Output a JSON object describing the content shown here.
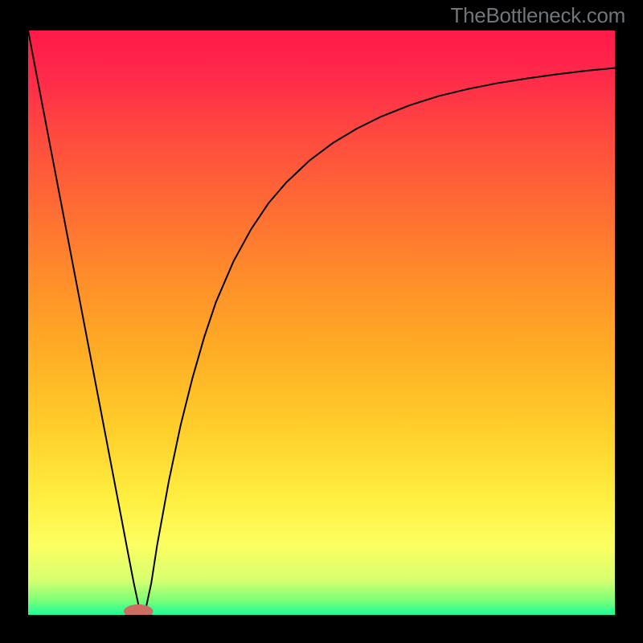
{
  "attribution": "TheBottleneck.com",
  "chart_data": {
    "type": "line",
    "title": "",
    "xlabel": "",
    "ylabel": "",
    "xlim": [
      0,
      100
    ],
    "ylim": [
      0,
      100
    ],
    "grid": false,
    "series": [
      {
        "name": "curve",
        "x": [
          0,
          2,
          4,
          6,
          8,
          10,
          12,
          14,
          16,
          17,
          18,
          19,
          20,
          21,
          22,
          24,
          26,
          28,
          30,
          32,
          35,
          38,
          41,
          44,
          48,
          52,
          56,
          60,
          65,
          70,
          75,
          80,
          85,
          90,
          95,
          100
        ],
        "y": [
          100,
          89.5,
          79.0,
          68.5,
          58.0,
          47.5,
          37.0,
          26.5,
          16.0,
          10.7,
          5.5,
          0.8,
          0.8,
          5.5,
          12.0,
          23.0,
          32.5,
          40.5,
          47.5,
          53.5,
          60.5,
          66.0,
          70.5,
          74.0,
          77.8,
          80.8,
          83.2,
          85.2,
          87.2,
          88.8,
          90.0,
          91.0,
          91.8,
          92.5,
          93.1,
          93.6
        ]
      }
    ],
    "gradient_stops": [
      {
        "offset": 0.0,
        "color": "#ff1a4a"
      },
      {
        "offset": 0.08,
        "color": "#ff2a4a"
      },
      {
        "offset": 0.18,
        "color": "#ff4a3f"
      },
      {
        "offset": 0.3,
        "color": "#ff6b34"
      },
      {
        "offset": 0.42,
        "color": "#ff8c2a"
      },
      {
        "offset": 0.55,
        "color": "#ffad25"
      },
      {
        "offset": 0.68,
        "color": "#ffce2a"
      },
      {
        "offset": 0.8,
        "color": "#ffee40"
      },
      {
        "offset": 0.88,
        "color": "#fcff60"
      },
      {
        "offset": 0.94,
        "color": "#d8ff70"
      },
      {
        "offset": 0.975,
        "color": "#7cff78"
      },
      {
        "offset": 1.0,
        "color": "#18ff98"
      }
    ],
    "marker": {
      "x": 18.8,
      "y": 0.6,
      "rx": 2.5,
      "ry": 1.2,
      "color": "#cc6d63"
    }
  }
}
